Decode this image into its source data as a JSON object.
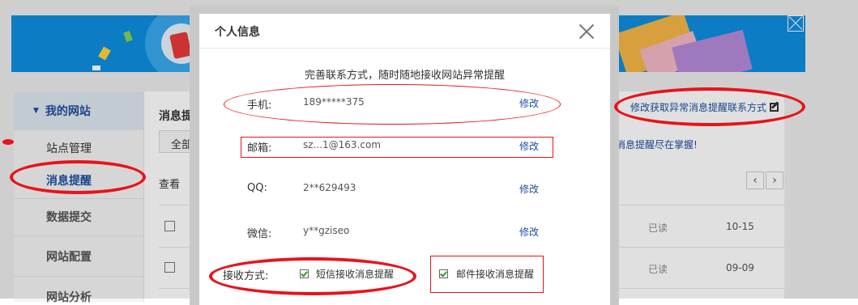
{
  "sidebar": {
    "header": "我的网站",
    "items": [
      "站点管理",
      "消息提醒",
      "数据提交",
      "网站配置",
      "网站分析"
    ],
    "active_index": 1
  },
  "main": {
    "title": "消息提",
    "filter_all": "全部",
    "view_label": "查看",
    "link_modify_contact": "修改获取异常消息提醒联系方式",
    "link_tip": "消息提醒尽在掌握!",
    "pager_prev": "‹",
    "pager_next": "›",
    "rows": [
      {
        "status": "已读",
        "date": "10-15"
      },
      {
        "status": "已读",
        "date": "09-09"
      }
    ]
  },
  "dialog": {
    "title": "个人信息",
    "subtitle": "完善联系方式，随时随地接收网站异常提醒",
    "fields": [
      {
        "label": "手机:",
        "value": "189*****375",
        "edit": "修改"
      },
      {
        "label": "邮箱:",
        "value": "sz...1@163.com",
        "edit": "修改"
      },
      {
        "label": "QQ:",
        "value": "2**629493",
        "edit": "修改"
      },
      {
        "label": "微信:",
        "value": "y**gziseo",
        "edit": "修改"
      }
    ],
    "receive_label": "接收方式:",
    "options": [
      {
        "label": "短信接收消息提醒",
        "checked": true
      },
      {
        "label": "邮件接收消息提醒",
        "checked": true
      }
    ]
  },
  "colors": {
    "accent": "#1d4fa0",
    "annotation": "#e8131b",
    "banner": "#0e8ee0"
  }
}
